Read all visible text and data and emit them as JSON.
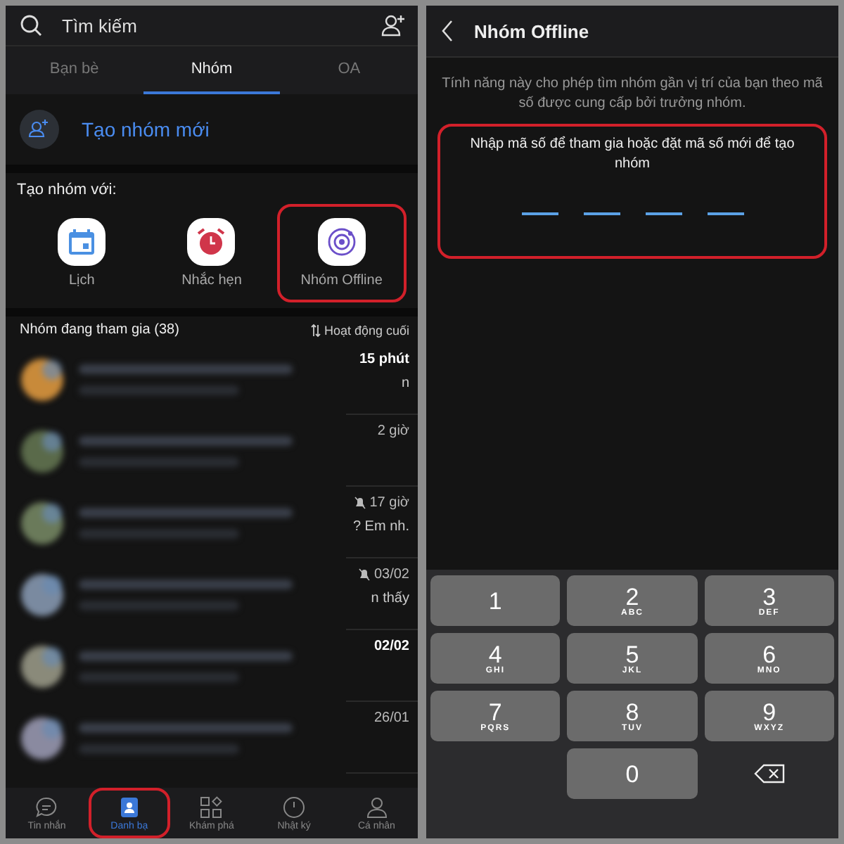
{
  "contacts_screen": {
    "search": {
      "placeholder": "Tìm kiếm"
    },
    "tabs": [
      {
        "label": "Bạn bè",
        "selected": false
      },
      {
        "label": "Nhóm",
        "selected": true
      },
      {
        "label": "OA",
        "selected": false
      }
    ],
    "create_group": "Tạo nhóm mới",
    "create_with": {
      "label": "Tạo nhóm với:",
      "options": [
        {
          "kind": "calendar",
          "label": "Lịch",
          "highlighted": false
        },
        {
          "kind": "alarm",
          "label": "Nhắc hẹn",
          "highlighted": false
        },
        {
          "kind": "offline",
          "label": "Nhóm Offline",
          "highlighted": true
        }
      ]
    },
    "groups_header": {
      "title": "Nhóm đang tham gia (38)",
      "sort": "Hoạt động cuối"
    },
    "groups": [
      {
        "time": "15 phút",
        "tail": "n",
        "muted": false,
        "unread": true
      },
      {
        "time": "2 giờ",
        "muted": false,
        "unread": false
      },
      {
        "time": "17 giờ",
        "tail": "? Em nh.",
        "muted": true,
        "unread": false
      },
      {
        "time": "03/02",
        "tail": "n thấy",
        "muted": true,
        "unread": false
      },
      {
        "time": "02/02",
        "muted": false,
        "unread": true
      },
      {
        "time": "26/01",
        "muted": false,
        "unread": false
      }
    ],
    "nav": [
      {
        "kind": "chat",
        "label": "Tin nhắn",
        "selected": false,
        "highlighted": false
      },
      {
        "kind": "contacts",
        "label": "Danh bạ",
        "selected": true,
        "highlighted": true
      },
      {
        "kind": "discover",
        "label": "Khám phá",
        "selected": false,
        "highlighted": false
      },
      {
        "kind": "diary",
        "label": "Nhật ký",
        "selected": false,
        "highlighted": false
      },
      {
        "kind": "profile",
        "label": "Cá nhân",
        "selected": false,
        "highlighted": false
      }
    ]
  },
  "offline_screen": {
    "title": "Nhóm Offline",
    "description": "Tính năng này cho phép tìm nhóm gần vị trí của bạn theo mã số được cung cấp bởi trưởng nhóm.",
    "code_box": {
      "prompt": "Nhập mã số để tham gia hoặc đặt mã số mới để tạo nhóm",
      "highlighted": true,
      "slots": [
        {
          "kind": "empty"
        },
        {
          "kind": "empty"
        },
        {
          "kind": "empty"
        },
        {
          "kind": "empty"
        }
      ]
    },
    "keypad": [
      {
        "kind": "digit",
        "digit": "1"
      },
      {
        "kind": "digit",
        "digit": "2",
        "letters": "ABC"
      },
      {
        "kind": "digit",
        "digit": "3",
        "letters": "DEF"
      },
      {
        "kind": "digit",
        "digit": "4",
        "letters": "GHI"
      },
      {
        "kind": "digit",
        "digit": "5",
        "letters": "JKL"
      },
      {
        "kind": "digit",
        "digit": "6",
        "letters": "MNO"
      },
      {
        "kind": "digit",
        "digit": "7",
        "letters": "PQRS"
      },
      {
        "kind": "digit",
        "digit": "8",
        "letters": "TUV"
      },
      {
        "kind": "digit",
        "digit": "9",
        "letters": "WXYZ"
      },
      {
        "kind": "blank"
      },
      {
        "kind": "digit",
        "digit": "0"
      },
      {
        "kind": "backspace"
      }
    ]
  }
}
